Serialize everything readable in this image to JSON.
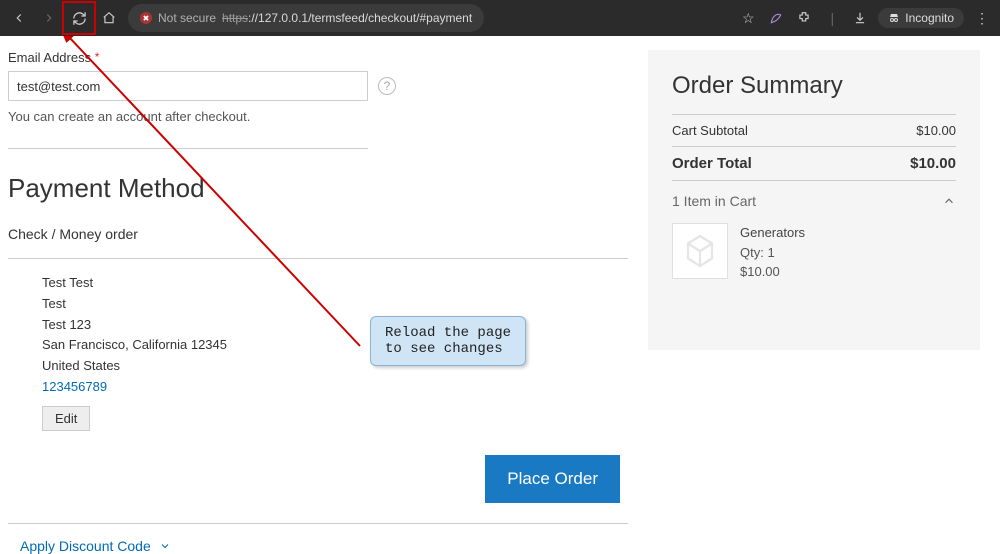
{
  "browser": {
    "not_secure_label": "Not secure",
    "url_struck": "https",
    "url_rest": "://127.0.0.1/termsfeed/checkout/#payment",
    "incognito_label": "Incognito"
  },
  "email": {
    "label": "Email Address",
    "value": "test@test.com",
    "note": "You can create an account after checkout."
  },
  "payment": {
    "heading": "Payment Method",
    "method_label": "Check / Money order",
    "address": {
      "name": "Test Test",
      "company": "Test",
      "street": "Test 123",
      "city_region": "San Francisco, California 12345",
      "country": "United States",
      "phone": "123456789"
    },
    "edit_label": "Edit",
    "place_order_label": "Place Order"
  },
  "discount": {
    "label": "Apply Discount Code"
  },
  "summary": {
    "title": "Order Summary",
    "subtotal_label": "Cart Subtotal",
    "subtotal_value": "$10.00",
    "total_label": "Order Total",
    "total_value": "$10.00",
    "items_label": "1 Item in Cart",
    "item": {
      "name": "Generators",
      "qty": "Qty: 1",
      "price": "$10.00"
    }
  },
  "annotation": {
    "line1": "Reload the page",
    "line2": "to see changes"
  }
}
